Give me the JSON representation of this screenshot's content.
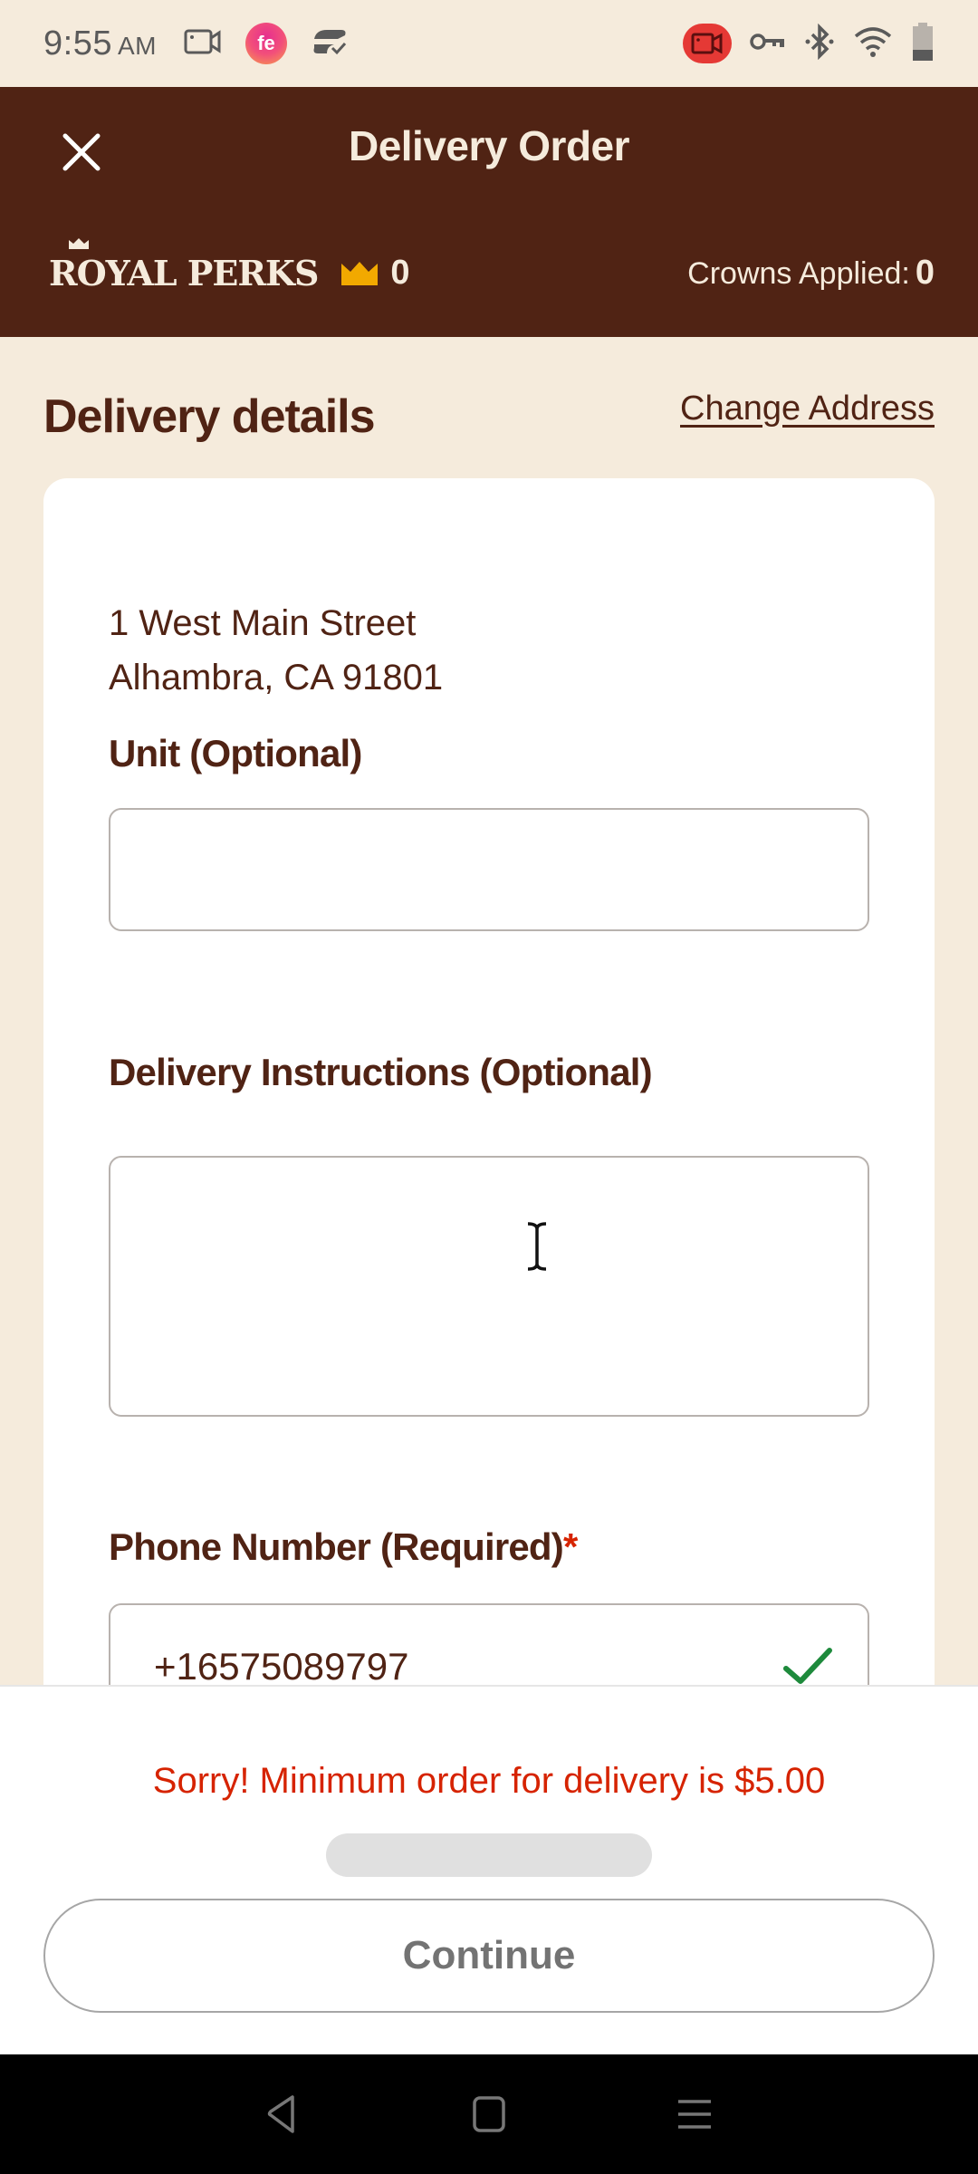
{
  "status_bar": {
    "time": "9:55",
    "ampm": "AM",
    "left_icons": [
      "screen-record-icon",
      "app-notification-icon",
      "sync-icon"
    ],
    "right_icons": [
      "recording-indicator-icon",
      "vpn-key-icon",
      "bluetooth-icon",
      "wifi-icon",
      "battery-icon"
    ],
    "app_icon_text": "fe"
  },
  "header": {
    "title": "Delivery Order",
    "close_icon": "close-icon",
    "perks_logo": "ROYAL PERKS",
    "crown_count": "0",
    "crowns_applied_label": "Crowns Applied:",
    "crowns_applied_value": "0"
  },
  "delivery": {
    "section_title": "Delivery details",
    "change_address_label": "Change Address",
    "address_line1": "1 West Main Street",
    "address_line2": "Alhambra, CA 91801",
    "unit_label": "Unit (Optional)",
    "unit_value": "",
    "instructions_label": "Delivery Instructions (Optional)",
    "instructions_value": "",
    "phone_label": "Phone Number (Required)",
    "phone_required_marker": "*",
    "phone_value": "+16575089797",
    "phone_valid": true
  },
  "footer": {
    "error_message": "Sorry! Minimum order for delivery is $5.00",
    "continue_label": "Continue",
    "continue_enabled": false
  },
  "nav_bar": {
    "items": [
      "back",
      "home",
      "recents"
    ]
  },
  "colors": {
    "brand_brown": "#502314",
    "cream_background": "#f5ebdc",
    "crown_gold": "#f2a900",
    "error_red": "#d62300",
    "valid_green": "#1e8a3c",
    "disabled_gray": "#737373"
  }
}
